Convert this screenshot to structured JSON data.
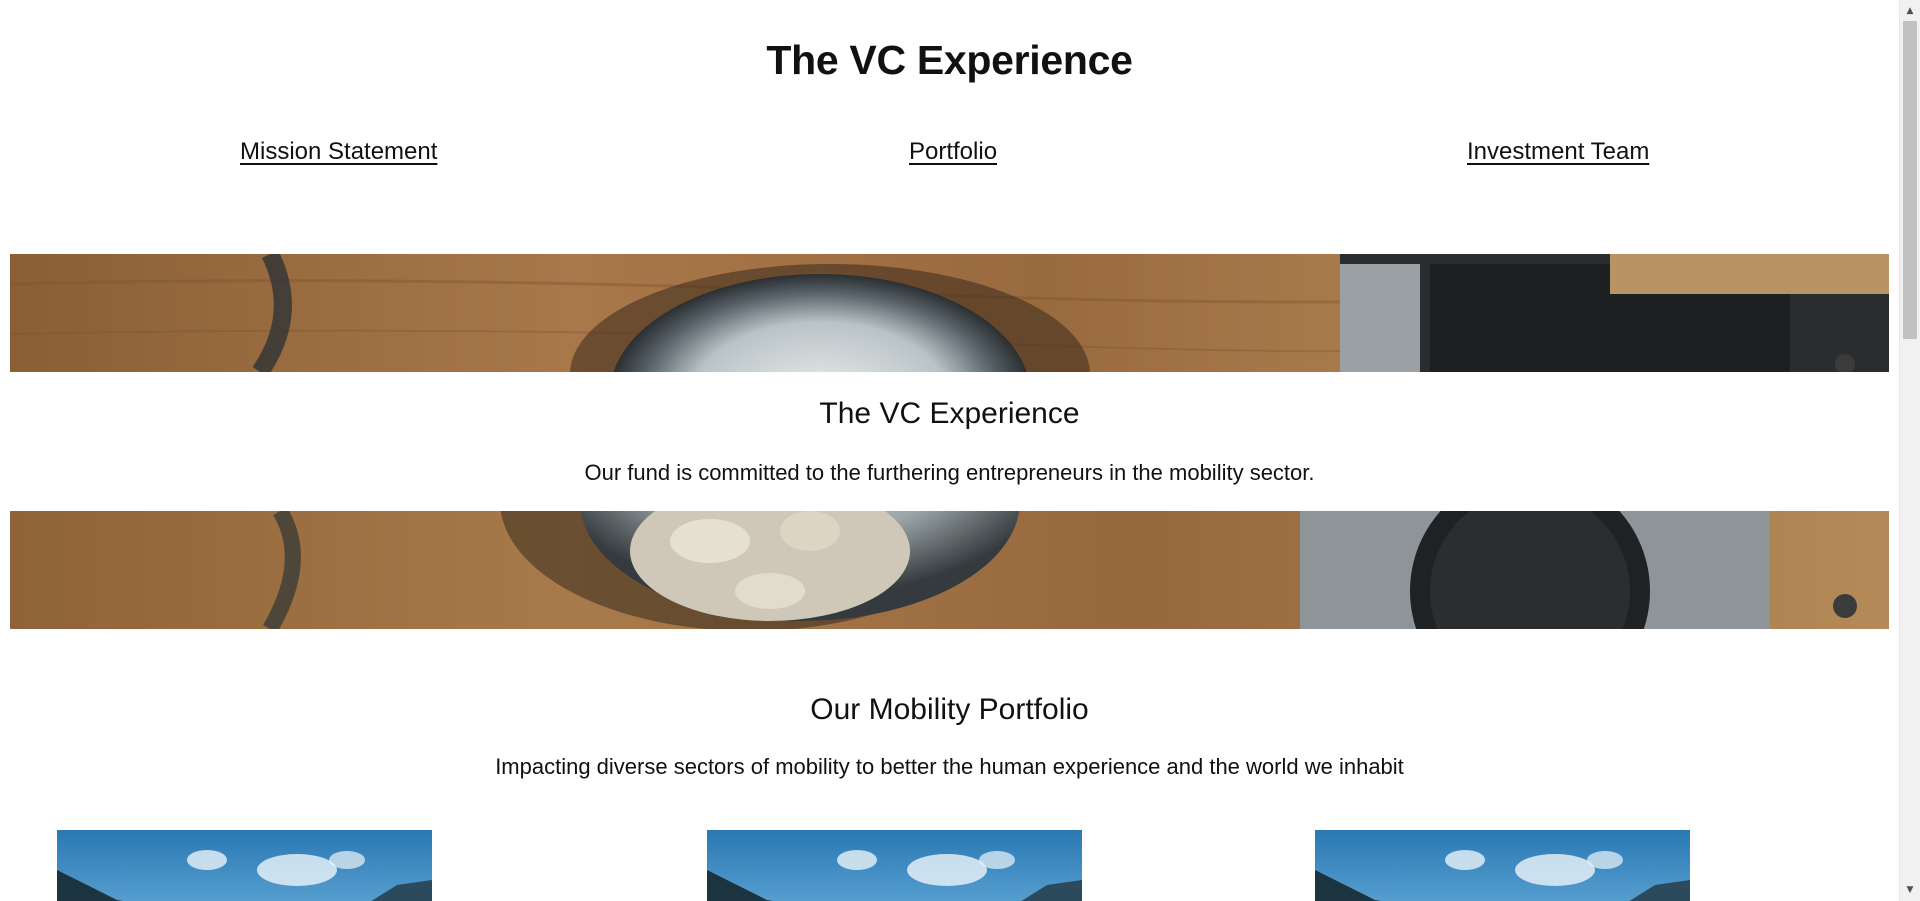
{
  "header": {
    "title": "The VC Experience"
  },
  "nav": {
    "items": [
      {
        "label": "Mission Statement"
      },
      {
        "label": "Portfolio"
      },
      {
        "label": "Investment Team"
      }
    ]
  },
  "hero": {
    "title": "The VC Experience",
    "text": "Our fund is committed to the furthering entrepreneurs in the mobility sector."
  },
  "portfolio": {
    "title": "Our Mobility Portfolio",
    "subtitle": "Impacting diverse sectors of mobility to better the human experience and the world we inhabit",
    "cards": [
      {
        "icon": "mountain-sky-photo"
      },
      {
        "icon": "mountain-sky-photo"
      },
      {
        "icon": "mountain-sky-photo"
      }
    ]
  },
  "theme": {
    "text_color": "#111111",
    "wood_color": "#9c6c3e",
    "sky_color": "#2f7fb4"
  }
}
